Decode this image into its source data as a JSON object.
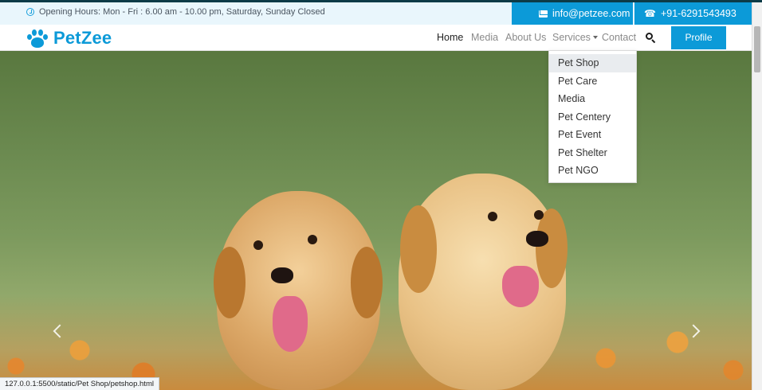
{
  "topbar": {
    "hours": "Opening Hours: Mon - Fri : 6.00 am - 10.00 pm, Saturday, Sunday Closed",
    "email": "info@petzee.com",
    "phone": "+91-6291543493"
  },
  "brand": {
    "name": "PetZee",
    "color": "#0c9ad8"
  },
  "nav": {
    "home": "Home",
    "media": "Media",
    "about": "About Us",
    "services": "Services",
    "contact": "Contact",
    "profile": "Profile"
  },
  "dropdown": {
    "items": [
      "Pet Shop",
      "Pet Care",
      "Media",
      "Pet Centery",
      "Pet Event",
      "Pet Shelter",
      "Pet NGO"
    ]
  },
  "status": {
    "url": "127.0.0.1:5500/static/Pet Shop/petshop.html"
  },
  "icons": [
    "clock-icon",
    "envelope-icon",
    "phone-icon",
    "paw-icon",
    "search-icon",
    "chevron-left-icon",
    "chevron-right-icon"
  ]
}
